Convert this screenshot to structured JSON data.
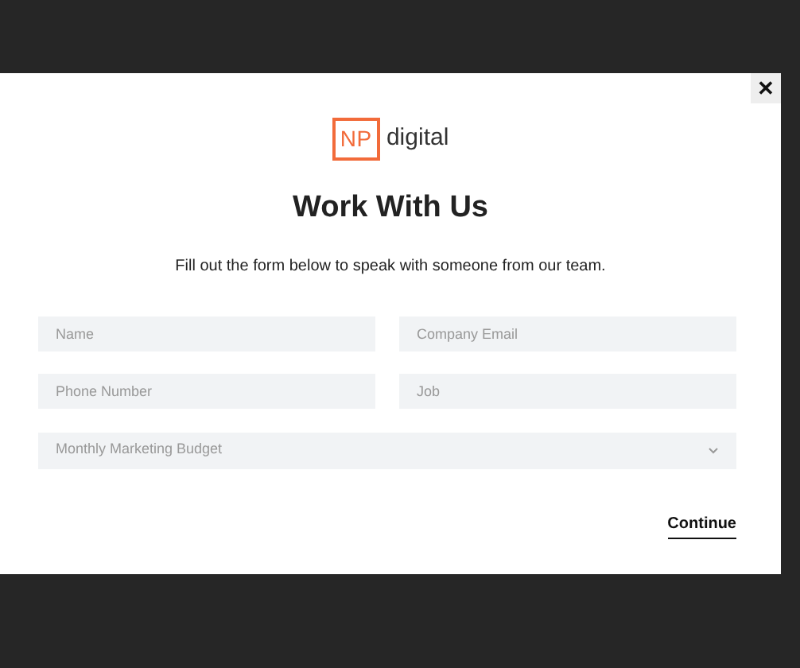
{
  "logo": {
    "mark": "NP",
    "word": "digital"
  },
  "close_button": {
    "label": "✕"
  },
  "title": "Work With Us",
  "subtitle": "Fill out the form below to speak with someone from our team.",
  "fields": [
    {
      "placeholder": "Name"
    },
    {
      "placeholder": "Company Email"
    },
    {
      "placeholder": "Phone Number"
    },
    {
      "placeholder": "Job"
    }
  ],
  "budget_select": {
    "placeholder": "Monthly Marketing Budget"
  },
  "continue_button": {
    "label": "Continue"
  }
}
